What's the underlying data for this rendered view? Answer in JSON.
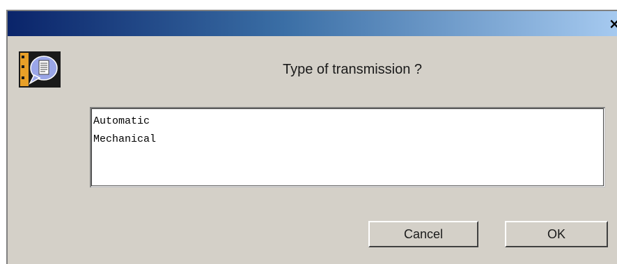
{
  "window": {
    "close_glyph": "×",
    "titlebar_gradient": [
      "#0a246a",
      "#3a6ea5",
      "#a6caf0"
    ],
    "background_color": "#d4d0c8"
  },
  "dialog": {
    "icon": "speech-bubble-document-icon",
    "prompt": "Type of transmission ?",
    "options": [
      {
        "label": "Automatic"
      },
      {
        "label": "Mechanical"
      }
    ]
  },
  "buttons": {
    "cancel_label": "Cancel",
    "ok_label": "OK"
  }
}
